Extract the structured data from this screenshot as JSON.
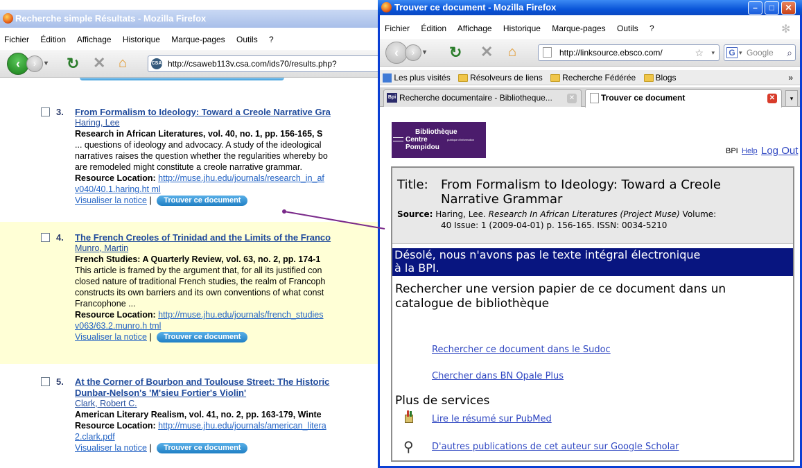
{
  "back_window": {
    "title": "Recherche simple Résultats - Mozilla Firefox",
    "menu": [
      "Fichier",
      "Édition",
      "Affichage",
      "Historique",
      "Marque-pages",
      "Outils",
      "?"
    ],
    "url": "http://csaweb113v.csa.com/ids70/results.php?",
    "results": [
      {
        "num": "3.",
        "title": "From Formalism to Ideology: Toward a Creole Narrative Gra",
        "author": "Haring, Lee",
        "source": "Research in African Literatures, vol. 40, no. 1, pp. 156-165, S",
        "abstract": [
          "... questions of ideology and advocacy. A study of the ideological",
          "narratives raises the question whether the regularities whereby bo",
          "are remodeled might constitute a creole narrative grammar."
        ],
        "resource_label": "Resource Location:",
        "resource_url_1": "http://muse.jhu.edu/journals/research_in_af",
        "resource_url_2": "v040/40.1.haring.ht ml",
        "notice": "Visualiser la notice",
        "sep": "|",
        "trouver": "Trouver ce document"
      },
      {
        "num": "4.",
        "title": "The French Creoles of Trinidad and the Limits of the Franco",
        "author": "Munro, Martin",
        "source": "French Studies: A Quarterly Review, vol. 63, no. 2, pp. 174-1",
        "abstract": [
          "This article is framed by the argument that, for all its justified con",
          "closed nature of traditional French studies, the realm of Francoph",
          "constructs its own barriers and its own conventions of what const",
          "Francophone ..."
        ],
        "resource_label": "Resource Location:",
        "resource_url_1": "http://muse.jhu.edu/journals/french_studies",
        "resource_url_2": "v063/63.2.munro.h tml",
        "notice": "Visualiser la notice",
        "sep": "|",
        "trouver": "Trouver ce document"
      },
      {
        "num": "5.",
        "title": "At the Corner of Bourbon and Toulouse Street: The Historic",
        "title2": "Dunbar-Nelson's 'M'sieu Fortier's Violin'",
        "author": "Clark, Robert C.",
        "source": "American Literary Realism, vol. 41, no. 2, pp. 163-179, Winte",
        "resource_label": "Resource Location:",
        "resource_url_1": "http://muse.jhu.edu/journals/american_litera",
        "resource_url_2": "2.clark.pdf",
        "notice": "Visualiser la notice",
        "sep": "|",
        "trouver": "Trouver ce document"
      }
    ]
  },
  "front_window": {
    "title": "Trouver ce document - Mozilla Firefox",
    "menu": [
      "Fichier",
      "Édition",
      "Affichage",
      "Historique",
      "Marque-pages",
      "Outils",
      "?"
    ],
    "url": "http://linksource.ebsco.com/",
    "search_engine": "Google",
    "bookmarks": [
      "Les plus visités",
      "Résolveurs de liens",
      "Recherche Fédérée",
      "Blogs"
    ],
    "bookmarks_more": "»",
    "tabs": [
      {
        "label": "Recherche documentaire - Bibliotheque...",
        "favicon": "Bpi"
      },
      {
        "label": "Trouver ce document"
      }
    ],
    "logo": {
      "line1": "Bibliothèque",
      "line2": "Centre",
      "line3": "Pompidou",
      "sub": "publique d'information"
    },
    "header_links": {
      "bpi": "BPI",
      "help": "Help",
      "logout": "Log Out"
    },
    "title_label": "Title:",
    "title_text_1": "From Formalism to Ideology: Toward a Creole",
    "title_text_2": "Narrative Grammar",
    "source_label": "Source:",
    "source_author": "Haring, Lee.",
    "source_journal": "Research In African Literatures (Project Muse)",
    "source_rest_1": "Volume:",
    "source_rest_2": "40 Issue: 1 (2009-04-01) p. 156-165. ISSN: 0034-5210",
    "sorry_1": "Désolé, nous n'avons pas le texte intégral électronique",
    "sorry_2": "à la BPI.",
    "search_paper_1": "Rechercher une version papier de ce document dans un",
    "search_paper_2": "catalogue de bibliothèque",
    "link_sudoc": "Rechercher ce document dans le Sudoc",
    "link_opale": "Chercher dans BN Opale Plus",
    "plus_services": "Plus de services",
    "link_pubmed": "Lire le résumé sur PubMed",
    "link_scholar": "D'autres publications de cet auteur sur Google Scholar"
  }
}
